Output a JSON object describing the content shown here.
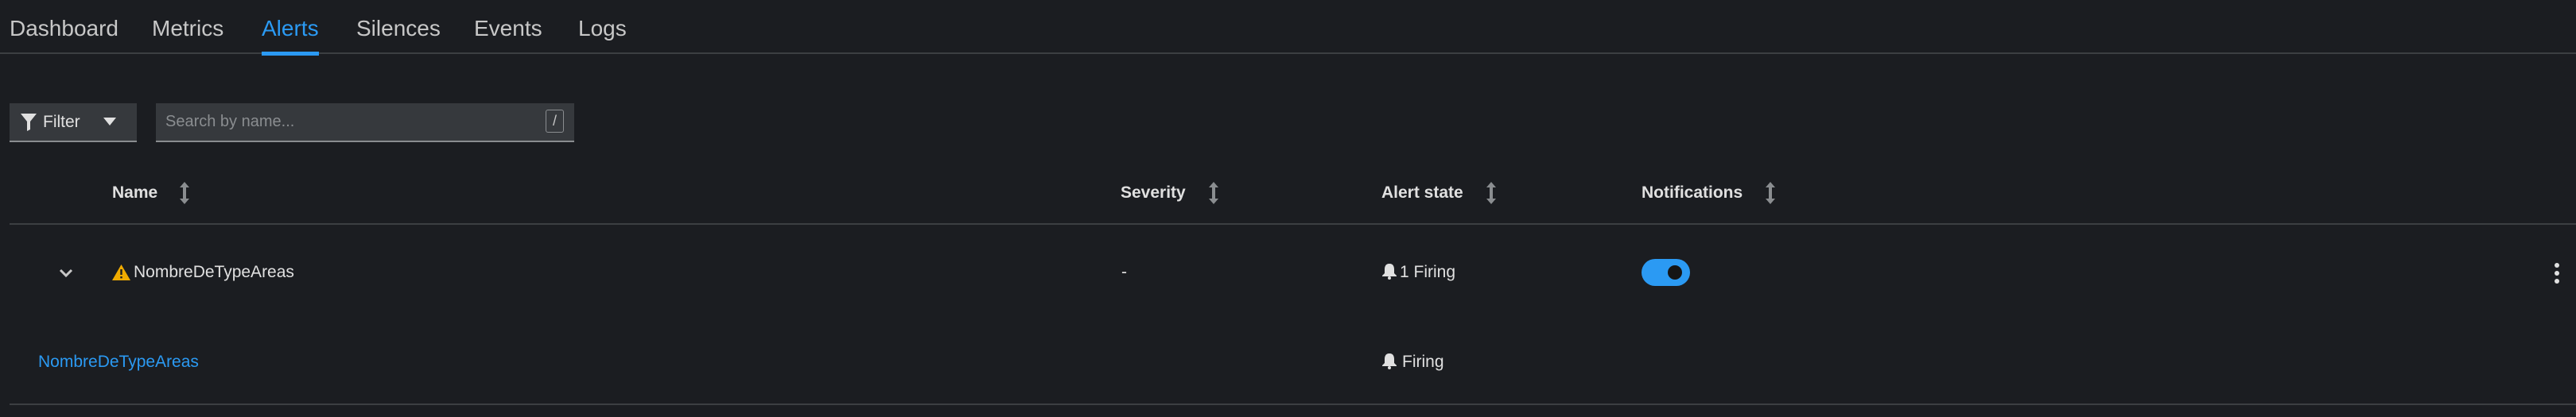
{
  "tabs": [
    {
      "label": "Dashboard"
    },
    {
      "label": "Metrics"
    },
    {
      "label": "Alerts",
      "active": true
    },
    {
      "label": "Silences"
    },
    {
      "label": "Events"
    },
    {
      "label": "Logs"
    }
  ],
  "toolbar": {
    "filter_label": "Filter",
    "search_placeholder": "Search by name...",
    "search_value": "",
    "search_shortcut": "/"
  },
  "table": {
    "columns": [
      {
        "label": "Name"
      },
      {
        "label": "Severity"
      },
      {
        "label": "Alert state"
      },
      {
        "label": "Notifications"
      }
    ],
    "rows": [
      {
        "name": "NombreDeTypeAreas",
        "severity": "-",
        "state": "1 Firing",
        "notifications_enabled": true,
        "icon": "warning-triangle-icon",
        "expanded": true,
        "children": [
          {
            "name": "NombreDeTypeAreas",
            "state": "Firing",
            "icon": "bell-icon"
          }
        ]
      }
    ]
  },
  "colors": {
    "accent": "#2b9af3",
    "warning": "#f0ab00",
    "background": "#1b1d21"
  }
}
